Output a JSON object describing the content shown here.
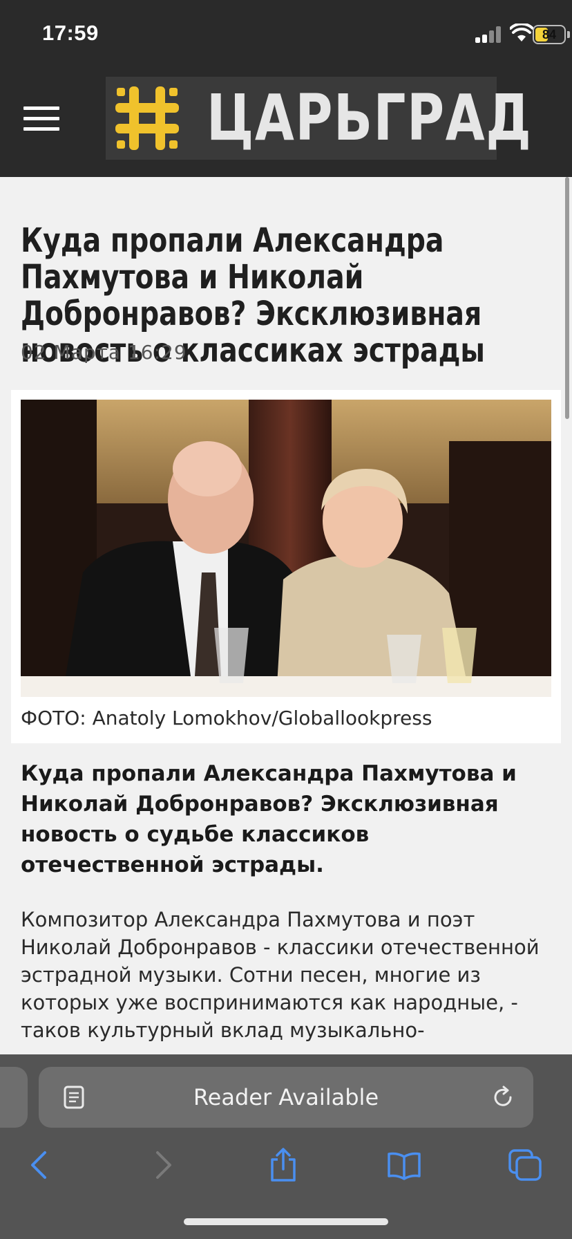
{
  "status_bar": {
    "time": "17:59",
    "battery": "84",
    "battery_fraction": 0.4,
    "icons": [
      "signal-icon",
      "wifi-icon",
      "battery-icon"
    ]
  },
  "header": {
    "menu_icon": "hamburger-menu-icon",
    "logo_text": "ЦАРЬГРАД",
    "logo_colors": {
      "mark": "#f0c22c",
      "background": "#3a3a3a",
      "bar": "#2a2a2a"
    }
  },
  "article": {
    "headline": "Куда пропали Александра Пахмутова и Николай Добронравов? Эксклюзивная новость о классиках эстрады",
    "date": "02 Марта 16:29",
    "caption": "ФОТО: Anatoly Lomokhov/Globallookpress",
    "lead": "Куда пропали Александра Пахмутова и Николай Добронравов? Эксклюзивная новость о судьбе классиков отечественной эстрады.",
    "body": "Композитор Александра Пахмутова и поэт Николай Добронравов - классики отечественной эстрадной музыки. Сотни песен, многие из которых уже воспринимаются как народные, - таков культурный вклад музыкально-"
  },
  "browser": {
    "address_text": "Reader Available",
    "icons": [
      "reader-icon",
      "reload-icon",
      "back-icon",
      "forward-icon",
      "share-icon",
      "bookmarks-icon",
      "tabs-icon"
    ],
    "accent": "#3b82f6"
  }
}
